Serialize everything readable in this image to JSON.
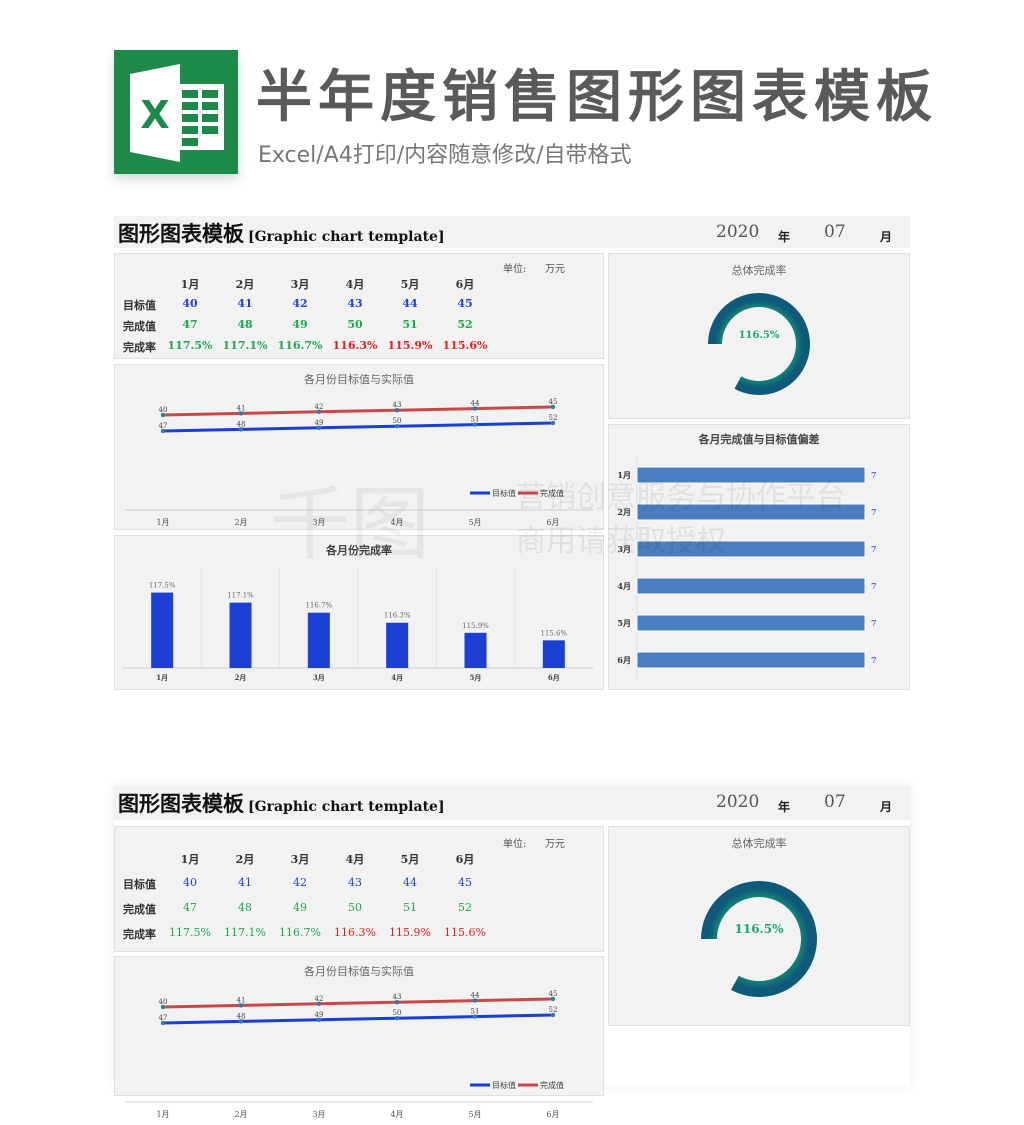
{
  "banner": {
    "title": "半年度销售图形图表模板",
    "subtitle": "Excel/A4打印/内容随意修改/自带格式",
    "logo_letter": "X",
    "logo_icon": "excel-icon"
  },
  "sheet": {
    "title_cn": "图形图表模板",
    "title_en": "[Graphic chart template]",
    "year": "2020",
    "year_unit": "年",
    "month": "07",
    "month_unit": "月",
    "unit_label": "单位:",
    "unit_value": "万元"
  },
  "table": {
    "months": [
      "1月",
      "2月",
      "3月",
      "4月",
      "5月",
      "6月"
    ],
    "rows": [
      {
        "label": "目标值",
        "values": [
          "40",
          "41",
          "42",
          "43",
          "44",
          "45"
        ]
      },
      {
        "label": "完成值",
        "values": [
          "47",
          "48",
          "49",
          "50",
          "51",
          "52"
        ]
      },
      {
        "label": "完成率",
        "values": [
          "117.5%",
          "117.1%",
          "116.7%",
          "116.3%",
          "115.9%",
          "115.6%"
        ]
      }
    ]
  },
  "colors": {
    "target": "#2244cc",
    "actual": "#1fa84f",
    "rate_high": "#1fa84f",
    "rate_low": "#e02020",
    "line_target": "#1a3fd6",
    "line_actual": "#c84848",
    "bar": "#1c3fd4",
    "hbar": "#4a7ec0",
    "donut_dark": "#0f5a7a",
    "donut_light": "#1aa870",
    "excel_green": "#1e8a4a"
  },
  "watermark": {
    "line1": "营销创意服务与协作平台",
    "line2": "商用请获取授权",
    "logo": "千图"
  },
  "chart_data": [
    {
      "type": "line",
      "title": "各月份目标值与实际值",
      "categories": [
        "1月",
        "2月",
        "3月",
        "4月",
        "5月",
        "6月"
      ],
      "series": [
        {
          "name": "目标值",
          "values": [
            40,
            41,
            42,
            43,
            44,
            45
          ]
        },
        {
          "name": "完成值",
          "values": [
            47,
            48,
            49,
            50,
            51,
            52
          ]
        }
      ],
      "legend": "bottom-right",
      "grid": false
    },
    {
      "type": "bar",
      "title": "各月份完成率",
      "categories": [
        "1月",
        "2月",
        "3月",
        "4月",
        "5月",
        "6月"
      ],
      "values": [
        117.5,
        117.1,
        116.7,
        116.3,
        115.9,
        115.6
      ],
      "labels": [
        "117.5%",
        "117.1%",
        "116.7%",
        "116.3%",
        "115.9%",
        "115.6%"
      ],
      "ylim": [
        114.5,
        118
      ]
    },
    {
      "type": "pie",
      "title": "总体完成率",
      "value": 116.5,
      "label": "116.5%",
      "style": "donut"
    },
    {
      "type": "bar",
      "orientation": "horizontal",
      "title": "各月完成值与目标值偏差",
      "categories": [
        "1月",
        "2月",
        "3月",
        "4月",
        "5月",
        "6月"
      ],
      "values": [
        7,
        7,
        7,
        7,
        7,
        7
      ],
      "labels": [
        "7",
        "7",
        "7",
        "7",
        "7",
        "7"
      ]
    }
  ]
}
